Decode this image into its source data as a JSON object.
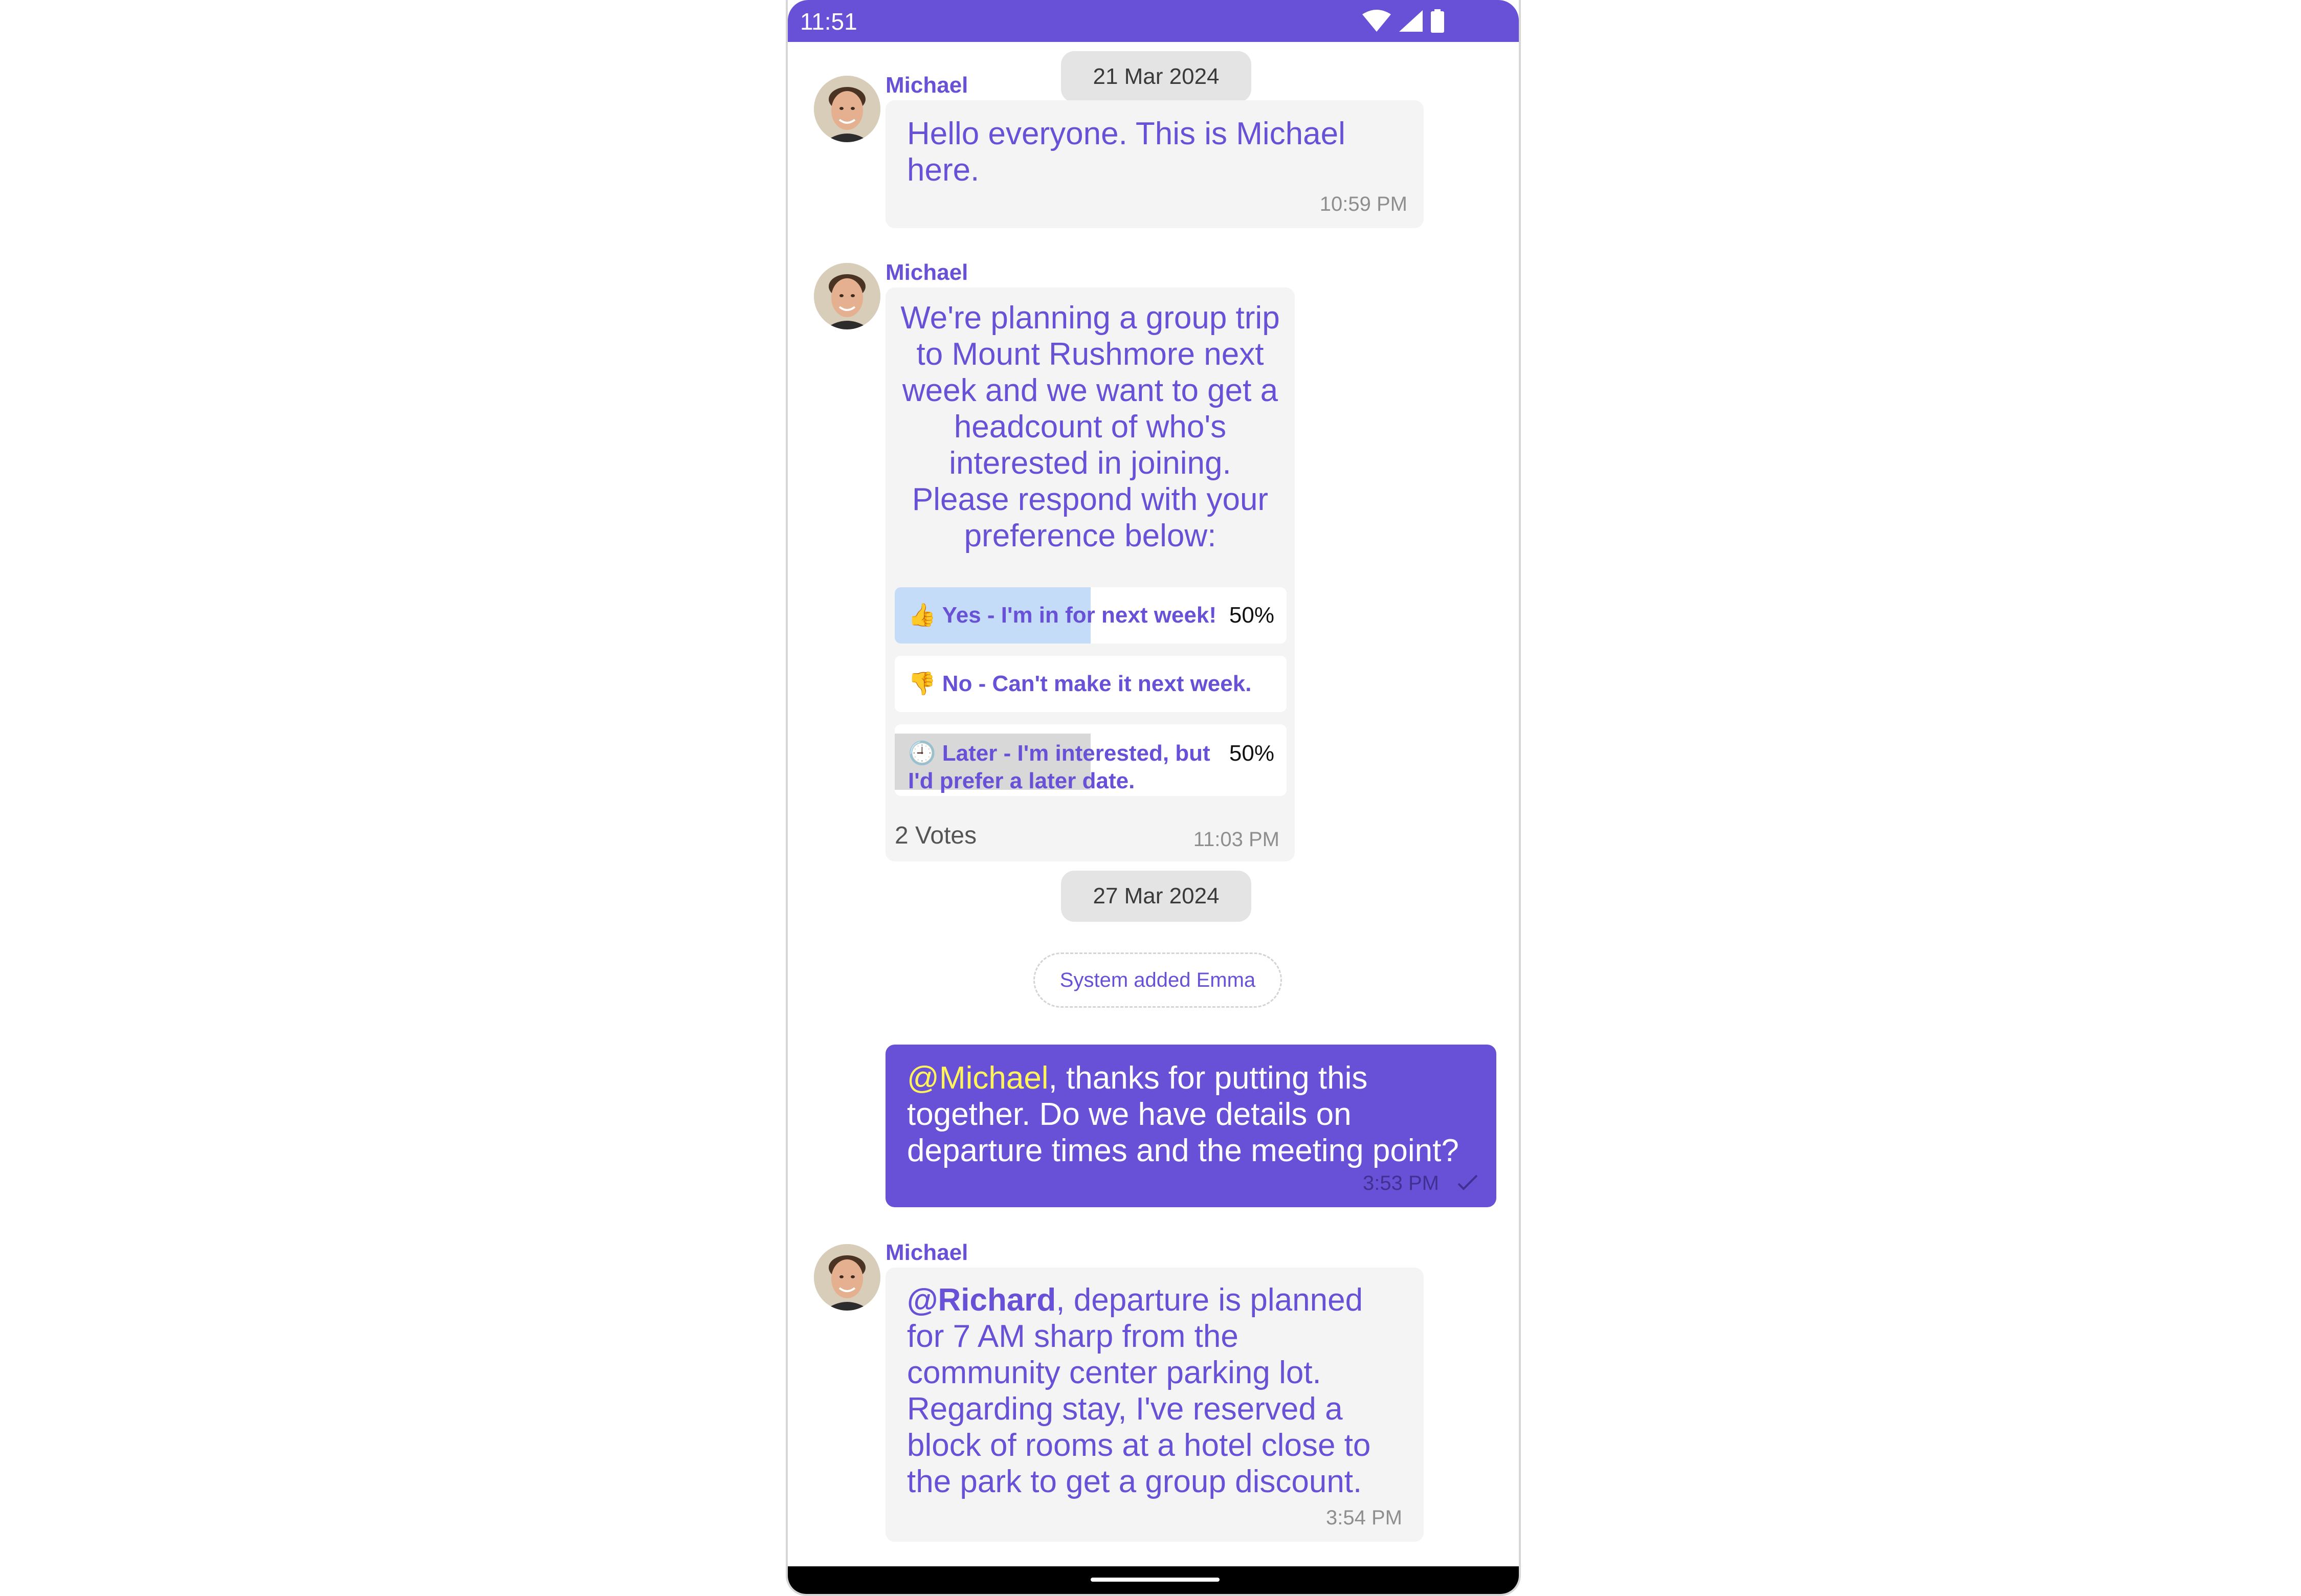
{
  "status_bar": {
    "time": "11:51",
    "icons": [
      "wifi-icon",
      "signal-icon",
      "battery-icon"
    ],
    "color": "#6851d6"
  },
  "dates": {
    "first": "21 Mar 2024",
    "second": "27 Mar 2024"
  },
  "messages": {
    "m1": {
      "sender": "Michael",
      "text": "Hello everyone. This is Michael here.",
      "time": "10:59 PM"
    },
    "poll": {
      "sender": "Michael",
      "question": "We're planning a group trip to Mount Rushmore next week and we want to get a headcount of who's interested in joining. Please respond with your preference below:",
      "options": [
        {
          "emoji": "👍",
          "label": "Yes - I'm in for next week!",
          "percent": "50%",
          "fraction": 0.5,
          "fill": "#c5dcf8"
        },
        {
          "emoji": "👎",
          "label": "No - Can't make it next week.",
          "percent": "",
          "fraction": 0,
          "fill": "#ffffff"
        },
        {
          "emoji": "🕘",
          "label": "Later - I'm interested, but I'd prefer a later date.",
          "percent": "50%",
          "fraction": 0.5,
          "fill": "#d8d8d8"
        }
      ],
      "votes": "2 Votes",
      "time": "11:03 PM"
    },
    "system": "System added Emma",
    "outgoing": {
      "mention": "@Michael",
      "text": ", thanks for putting this together. Do we have details on departure times and the meeting point?",
      "time": "3:53 PM"
    },
    "m4": {
      "sender": "Michael",
      "mention": "@Richard",
      "text": ", departure is planned for 7 AM sharp from the community center parking lot. Regarding stay, I've reserved a block of rooms at a hotel close to the park to get a group discount.",
      "time": "3:54 PM"
    }
  },
  "colors": {
    "accent": "#6851d6",
    "bubble": "#f4f4f4",
    "mention_highlight": "#fff45a"
  }
}
